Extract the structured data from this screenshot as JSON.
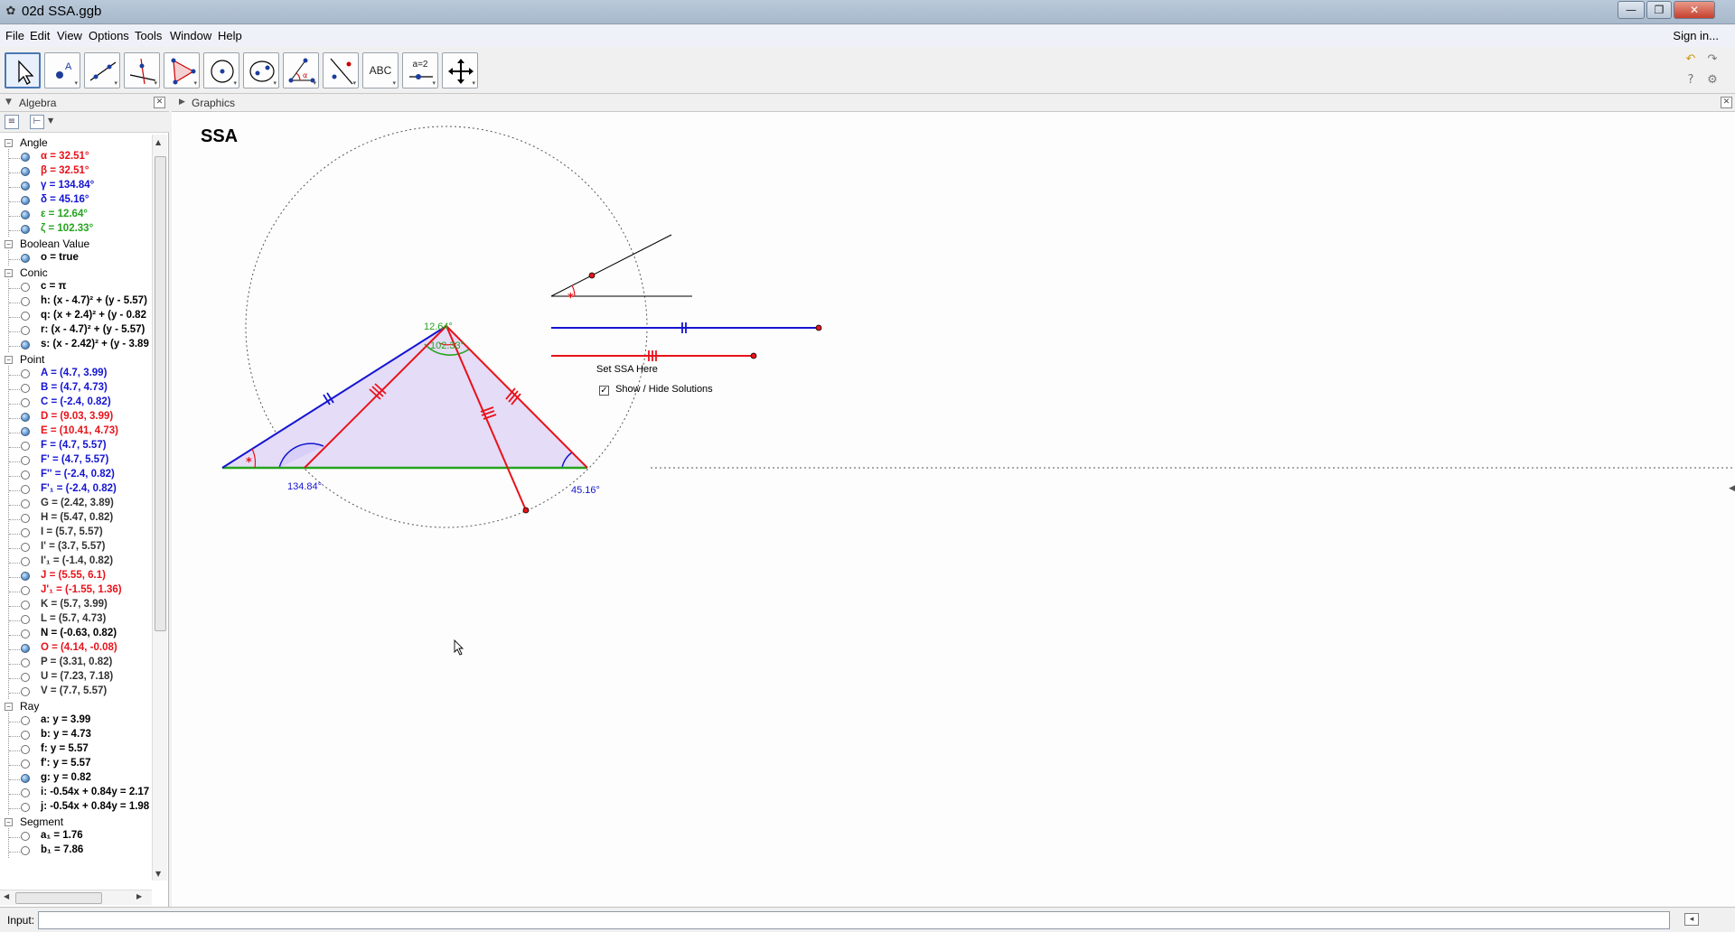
{
  "window": {
    "title": "02d SSA.ggb",
    "app_icon": "geogebra-icon",
    "controls": {
      "minimize": "—",
      "maximize": "❐",
      "close": "✕"
    }
  },
  "menu": {
    "items": [
      "File",
      "Edit",
      "View",
      "Options",
      "Tools",
      "Window",
      "Help"
    ],
    "signin": "Sign in..."
  },
  "toolbar": {
    "tools": [
      {
        "name": "move-tool",
        "selected": true
      },
      {
        "name": "point-tool"
      },
      {
        "name": "line-tool"
      },
      {
        "name": "perpendicular-line-tool"
      },
      {
        "name": "polygon-tool"
      },
      {
        "name": "circle-center-point-tool"
      },
      {
        "name": "ellipse-tool"
      },
      {
        "name": "angle-tool"
      },
      {
        "name": "reflect-tool"
      },
      {
        "name": "text-tool",
        "label": "ABC"
      },
      {
        "name": "slider-tool",
        "label": "a=2"
      },
      {
        "name": "move-graphics-view-tool"
      }
    ],
    "right_icons": [
      "undo-icon",
      "redo-icon",
      "help-icon",
      "settings-icon"
    ]
  },
  "algebra": {
    "title": "Algebra",
    "categories": [
      {
        "label": "Angle",
        "items": [
          {
            "text": "α = 32.51°",
            "color": "#e8121a",
            "visible": true
          },
          {
            "text": "β = 32.51°",
            "color": "#e8121a",
            "visible": true
          },
          {
            "text": "γ = 134.84°",
            "color": "#1414d2",
            "visible": true
          },
          {
            "text": "δ = 45.16°",
            "color": "#1414d2",
            "visible": true
          },
          {
            "text": "ε = 12.64°",
            "color": "#26a31f",
            "visible": true
          },
          {
            "text": "ζ = 102.33°",
            "color": "#26a31f",
            "visible": true
          }
        ]
      },
      {
        "label": "Boolean Value",
        "items": [
          {
            "text": "o = true",
            "color": "#000000",
            "visible": true
          }
        ]
      },
      {
        "label": "Conic",
        "items": [
          {
            "text": "c = π",
            "color": "#000000",
            "visible": false
          },
          {
            "text": "h: (x - 4.7)² + (y - 5.57)",
            "color": "#000000",
            "visible": false
          },
          {
            "text": "q: (x + 2.4)² + (y - 0.82",
            "color": "#000000",
            "visible": false
          },
          {
            "text": "r: (x - 4.7)² + (y - 5.57)",
            "color": "#000000",
            "visible": false
          },
          {
            "text": "s: (x - 2.42)² + (y - 3.89",
            "color": "#000000",
            "visible": true
          }
        ]
      },
      {
        "label": "Point",
        "items": [
          {
            "text": "A = (4.7, 3.99)",
            "color": "#1414d2",
            "visible": false
          },
          {
            "text": "B = (4.7, 4.73)",
            "color": "#1414d2",
            "visible": false
          },
          {
            "text": "C = (-2.4, 0.82)",
            "color": "#1414d2",
            "visible": false
          },
          {
            "text": "D = (9.03, 3.99)",
            "color": "#e8121a",
            "visible": true
          },
          {
            "text": "E = (10.41, 4.73)",
            "color": "#e8121a",
            "visible": true
          },
          {
            "text": "F = (4.7, 5.57)",
            "color": "#1414d2",
            "visible": false
          },
          {
            "text": "F' = (4.7, 5.57)",
            "color": "#1414d2",
            "visible": false
          },
          {
            "text": "F'' = (-2.4, 0.82)",
            "color": "#1414d2",
            "visible": false
          },
          {
            "text": "F'₁ = (-2.4, 0.82)",
            "color": "#1414d2",
            "visible": false
          },
          {
            "text": "G = (2.42, 3.89)",
            "color": "#333333",
            "visible": false
          },
          {
            "text": "H = (5.47, 0.82)",
            "color": "#333333",
            "visible": false
          },
          {
            "text": "I = (5.7, 5.57)",
            "color": "#333333",
            "visible": false
          },
          {
            "text": "I' = (3.7, 5.57)",
            "color": "#333333",
            "visible": false
          },
          {
            "text": "I'₁ = (-1.4, 0.82)",
            "color": "#333333",
            "visible": false
          },
          {
            "text": "J = (5.55, 6.1)",
            "color": "#e8121a",
            "visible": true
          },
          {
            "text": "J'₁ = (-1.55, 1.36)",
            "color": "#e8121a",
            "visible": false
          },
          {
            "text": "K = (5.7, 3.99)",
            "color": "#333333",
            "visible": false
          },
          {
            "text": "L = (5.7, 4.73)",
            "color": "#333333",
            "visible": false
          },
          {
            "text": "N = (-0.63, 0.82)",
            "color": "#000000",
            "visible": false
          },
          {
            "text": "O = (4.14, -0.08)",
            "color": "#e8121a",
            "visible": true
          },
          {
            "text": "P = (3.31, 0.82)",
            "color": "#333333",
            "visible": false
          },
          {
            "text": "U = (7.23, 7.18)",
            "color": "#333333",
            "visible": false
          },
          {
            "text": "V = (7.7, 5.57)",
            "color": "#333333",
            "visible": false
          }
        ]
      },
      {
        "label": "Ray",
        "items": [
          {
            "text": "a: y = 3.99",
            "color": "#000000",
            "visible": false
          },
          {
            "text": "b: y = 4.73",
            "color": "#000000",
            "visible": false
          },
          {
            "text": "f: y = 5.57",
            "color": "#000000",
            "visible": false
          },
          {
            "text": "f': y = 5.57",
            "color": "#000000",
            "visible": false
          },
          {
            "text": "g: y = 0.82",
            "color": "#000000",
            "visible": true
          },
          {
            "text": "i: -0.54x + 0.84y = 2.17",
            "color": "#000000",
            "visible": false
          },
          {
            "text": "j: -0.54x + 0.84y = 1.98",
            "color": "#000000",
            "visible": false
          }
        ]
      },
      {
        "label": "Segment",
        "items": [
          {
            "text": "a₁ = 1.76",
            "color": "#000000",
            "visible": false
          },
          {
            "text": "b₁ = 7.86",
            "color": "#000000",
            "visible": false
          }
        ]
      }
    ]
  },
  "graphics": {
    "title": "Graphics",
    "heading": "SSA",
    "labels": {
      "epsilon_value": "12.64°",
      "zeta_value": "102.33°",
      "gamma_value": "134.84°",
      "delta_value": "45.16°",
      "set_ssa": "Set SSA Here",
      "checkbox_label": "Show / Hide Solutions"
    },
    "checkbox_checked": true,
    "colors": {
      "blue": "#1414d2",
      "red": "#e8121a",
      "green": "#26a31f",
      "fill": "#e5dcf7"
    }
  },
  "input": {
    "label": "Input:",
    "placeholder": "",
    "value": ""
  }
}
